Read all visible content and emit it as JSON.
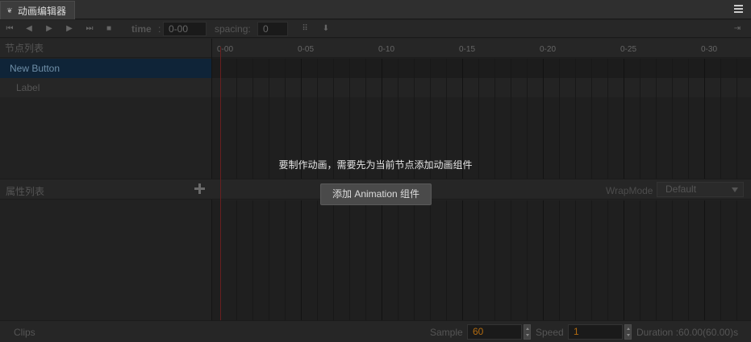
{
  "tab": {
    "title": "动画编辑器",
    "icon": "animation-icon"
  },
  "toolbar": {
    "buttons": [
      "jump-first-icon",
      "prev-frame-icon",
      "play-icon",
      "next-frame-icon",
      "jump-last-icon",
      "stop-icon"
    ],
    "time_label": "time",
    "time_value": "0-00",
    "spacing_label": "spacing:",
    "spacing_value": "0",
    "right_icon": "exit-icon"
  },
  "node_panel": {
    "title": "节点列表",
    "nodes": [
      {
        "label": "New Button",
        "selected": true
      },
      {
        "label": "Label",
        "selected": false
      }
    ]
  },
  "ruler": {
    "labels": [
      "0-00",
      "0-05",
      "0-10",
      "0-15",
      "0-20",
      "0-25",
      "0-30"
    ]
  },
  "overlay": {
    "message": "要制作动画，需要先为当前节点添加动画组件",
    "button_label": "添加 Animation 组件"
  },
  "properties": {
    "title": "属性列表",
    "wrapmode_label": "WrapMode",
    "wrapmode_value": "Default"
  },
  "footer": {
    "clips_label": "Clips",
    "sample_label": "Sample",
    "sample_value": "60",
    "speed_label": "Speed",
    "speed_value": "1",
    "duration_text": "Duration :60.00(60.00)s"
  },
  "colors": {
    "background": "#222222",
    "selected_row": "#0f2438",
    "playhead": "#6a1f1f",
    "input_value": "#b06a10",
    "button": "#4a4a4a"
  }
}
